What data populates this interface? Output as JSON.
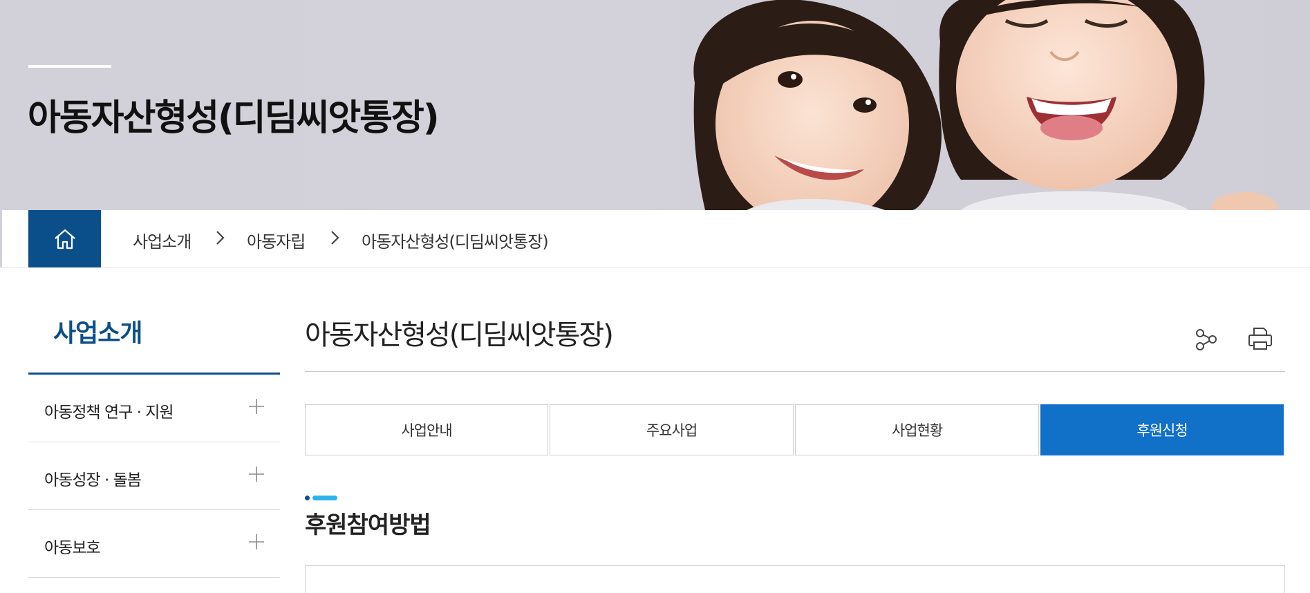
{
  "hero": {
    "title": "아동자산형성(디딤씨앗통장)"
  },
  "breadcrumb": {
    "home_icon": "home-icon",
    "items": [
      "사업소개",
      "아동자립",
      "아동자산형성(디딤씨앗통장)"
    ]
  },
  "sidebar": {
    "title": "사업소개",
    "items": [
      {
        "label": "아동정책 연구 · 지원"
      },
      {
        "label": "아동성장 · 돌봄"
      },
      {
        "label": "아동보호"
      }
    ]
  },
  "main": {
    "title": "아동자산형성(디딤씨앗통장)",
    "share_icon": "share-icon",
    "print_icon": "print-icon",
    "tabs": [
      {
        "label": "사업안내",
        "active": false
      },
      {
        "label": "주요사업",
        "active": false
      },
      {
        "label": "사업현황",
        "active": false
      },
      {
        "label": "후원신청",
        "active": true
      }
    ],
    "section_title": "후원참여방법"
  },
  "colors": {
    "primary": "#0b4f8a",
    "tab_active": "#1170c8",
    "accent": "#2bb3ea",
    "hero_bg": "#d2d0d8"
  }
}
